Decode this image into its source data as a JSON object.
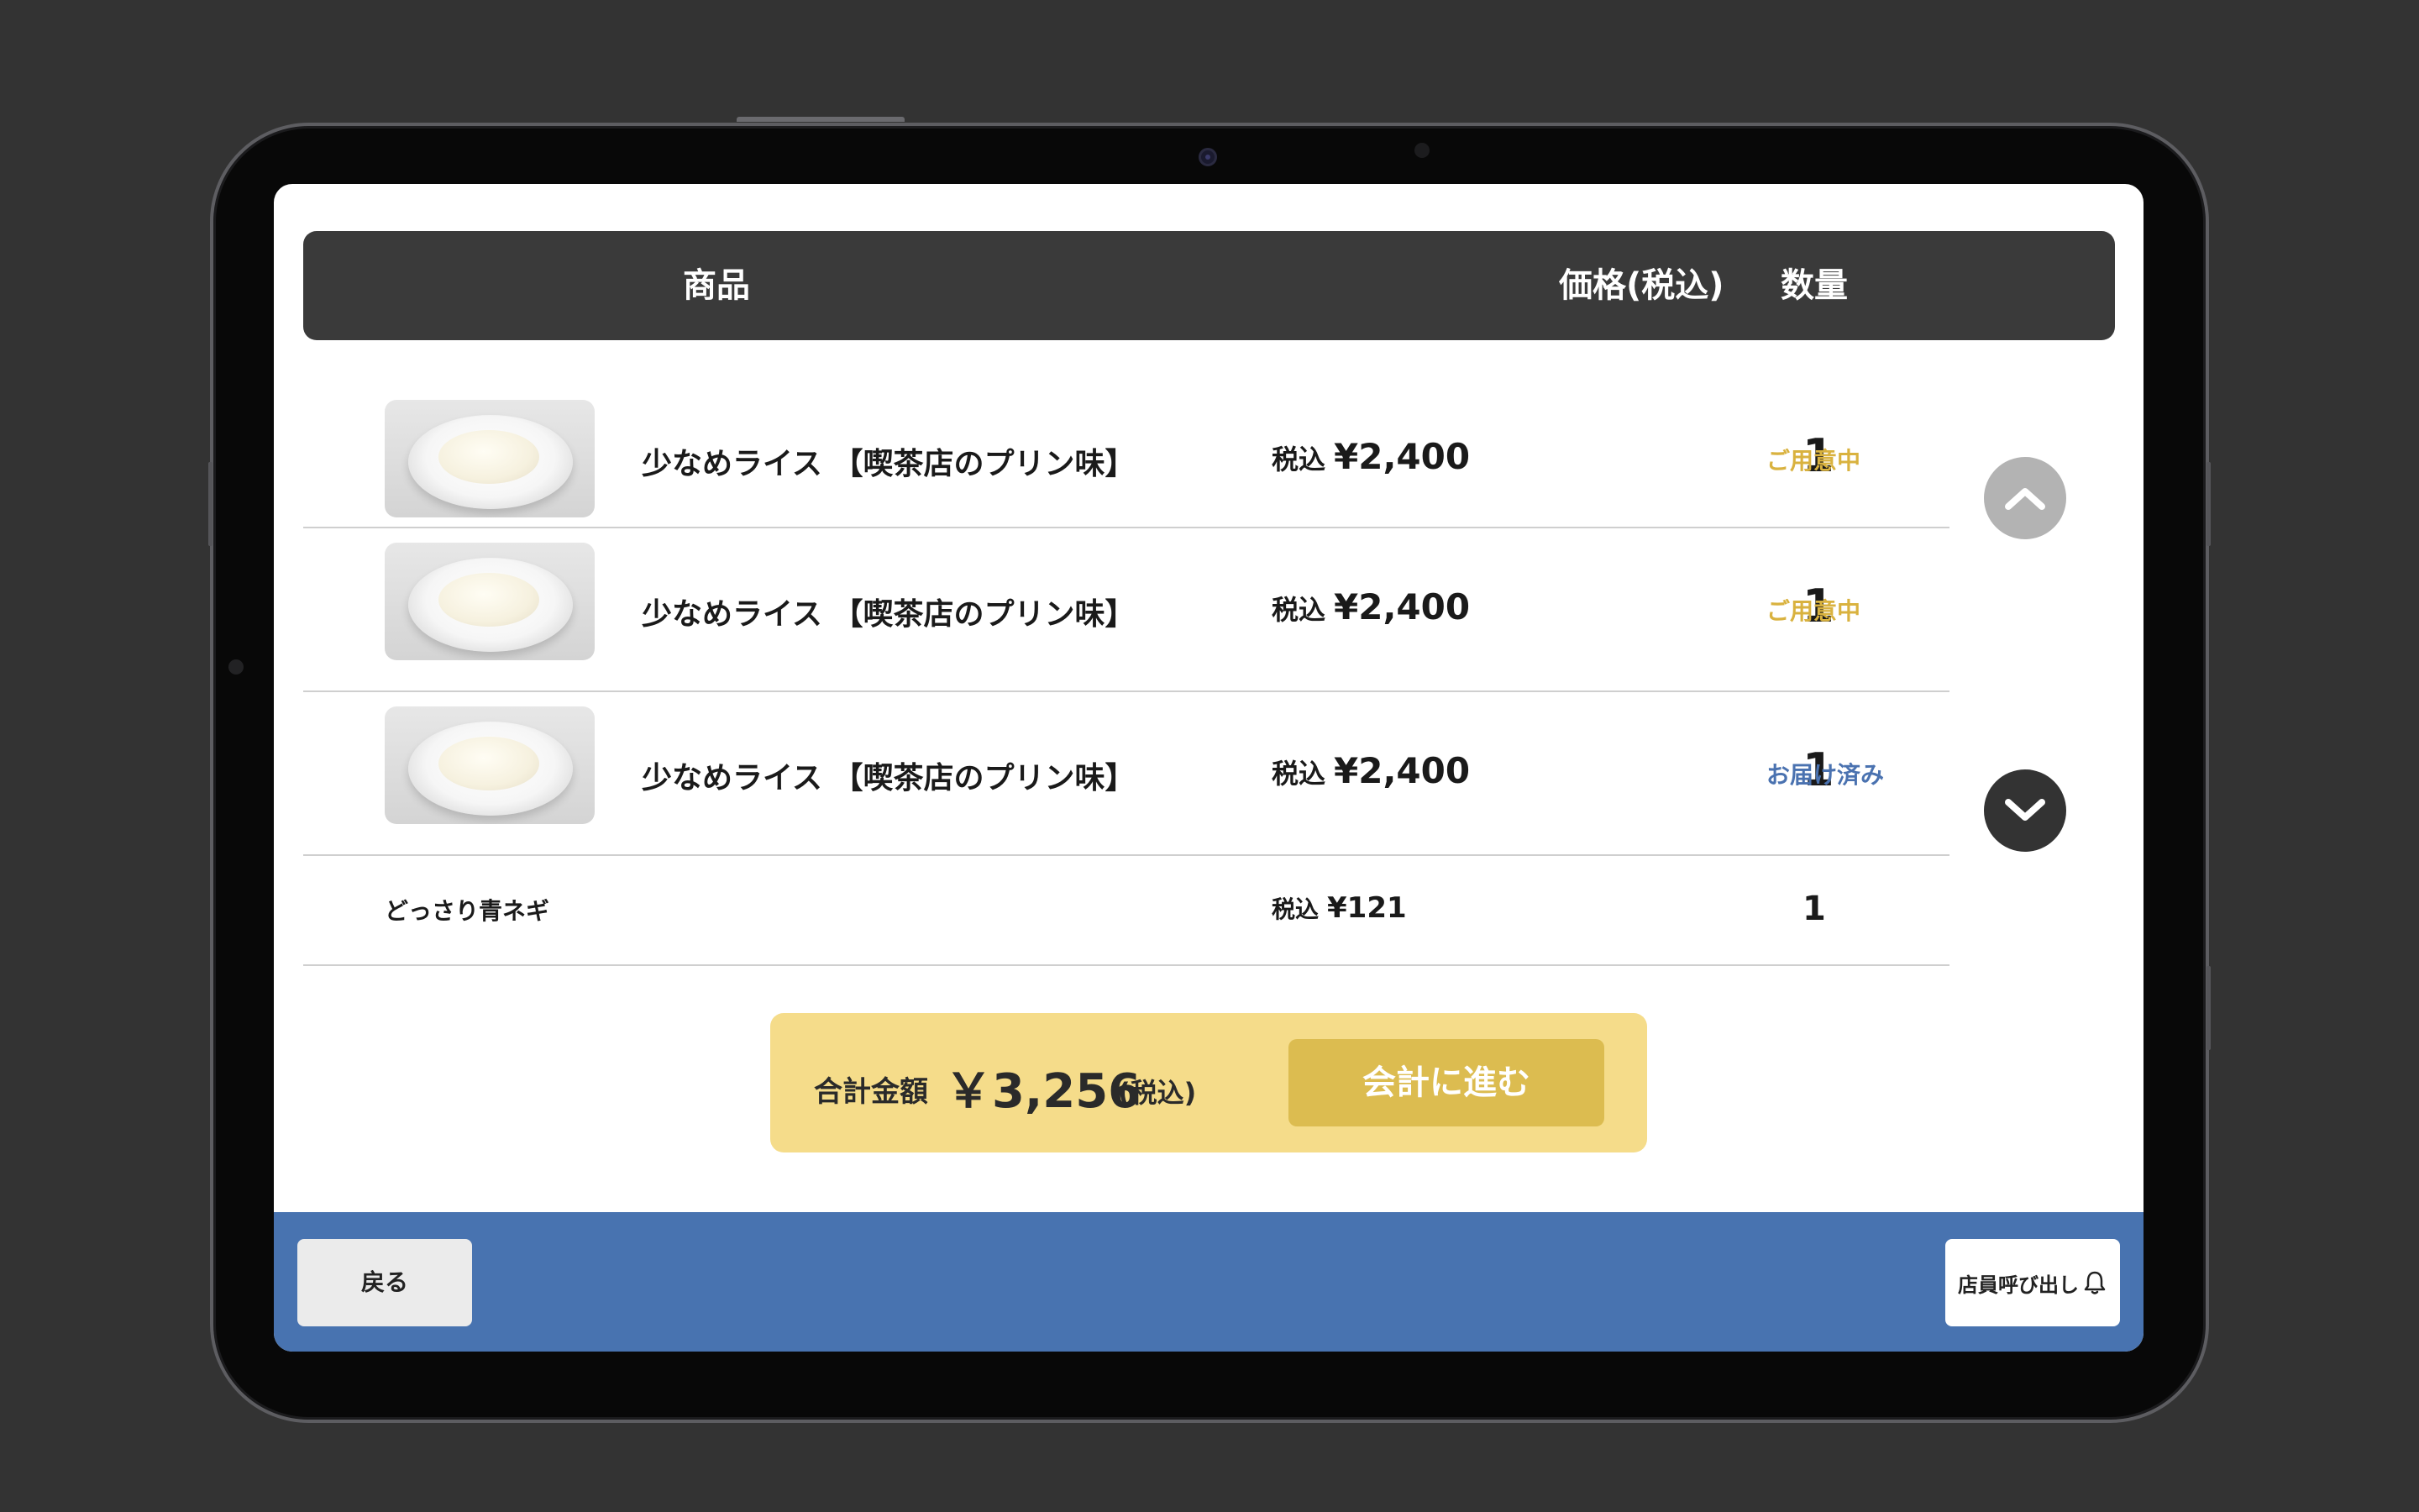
{
  "header": {
    "product": "商品",
    "price": "価格(税込)",
    "quantity": "数量"
  },
  "items": [
    {
      "name": "少なめライス 【喫茶店のプリン味】",
      "tax_label": "税込",
      "price": "¥2,400",
      "qty": "1",
      "status": "ご用意中",
      "status_color": "#d9b23f",
      "image": "rice-plate"
    },
    {
      "name": "少なめライス 【喫茶店のプリン味】",
      "tax_label": "税込",
      "price": "¥2,400",
      "qty": "1",
      "status": "ご用意中",
      "status_color": "#d9b23f",
      "image": "rice-plate"
    },
    {
      "name": "少なめライス 【喫茶店のプリン味】",
      "tax_label": "税込",
      "price": "¥2,400",
      "qty": "1",
      "status": "お届け済み",
      "status_color": "#4a72b0",
      "image": "rice-plate"
    },
    {
      "name": "どっさり青ネギ",
      "tax_label": "税込",
      "price": "¥121",
      "qty": "1"
    }
  ],
  "scroll": {
    "up_icon": "chevron-up-icon",
    "down_icon": "chevron-down-icon",
    "up_color": "#b3b3b3",
    "down_color": "#333333"
  },
  "total": {
    "label": "合計金額",
    "amount": "￥3,256",
    "tax_note": "(税込)",
    "checkout_label": "会計に進む"
  },
  "footer": {
    "back_label": "戻る",
    "call_label": "店員呼び出し",
    "call_icon": "bell-icon"
  },
  "colors": {
    "header_bg": "#3a3a3a",
    "footer_bg": "#4873b0",
    "total_panel_bg": "#f5dc8a",
    "checkout_bg": "#dcbc50"
  }
}
